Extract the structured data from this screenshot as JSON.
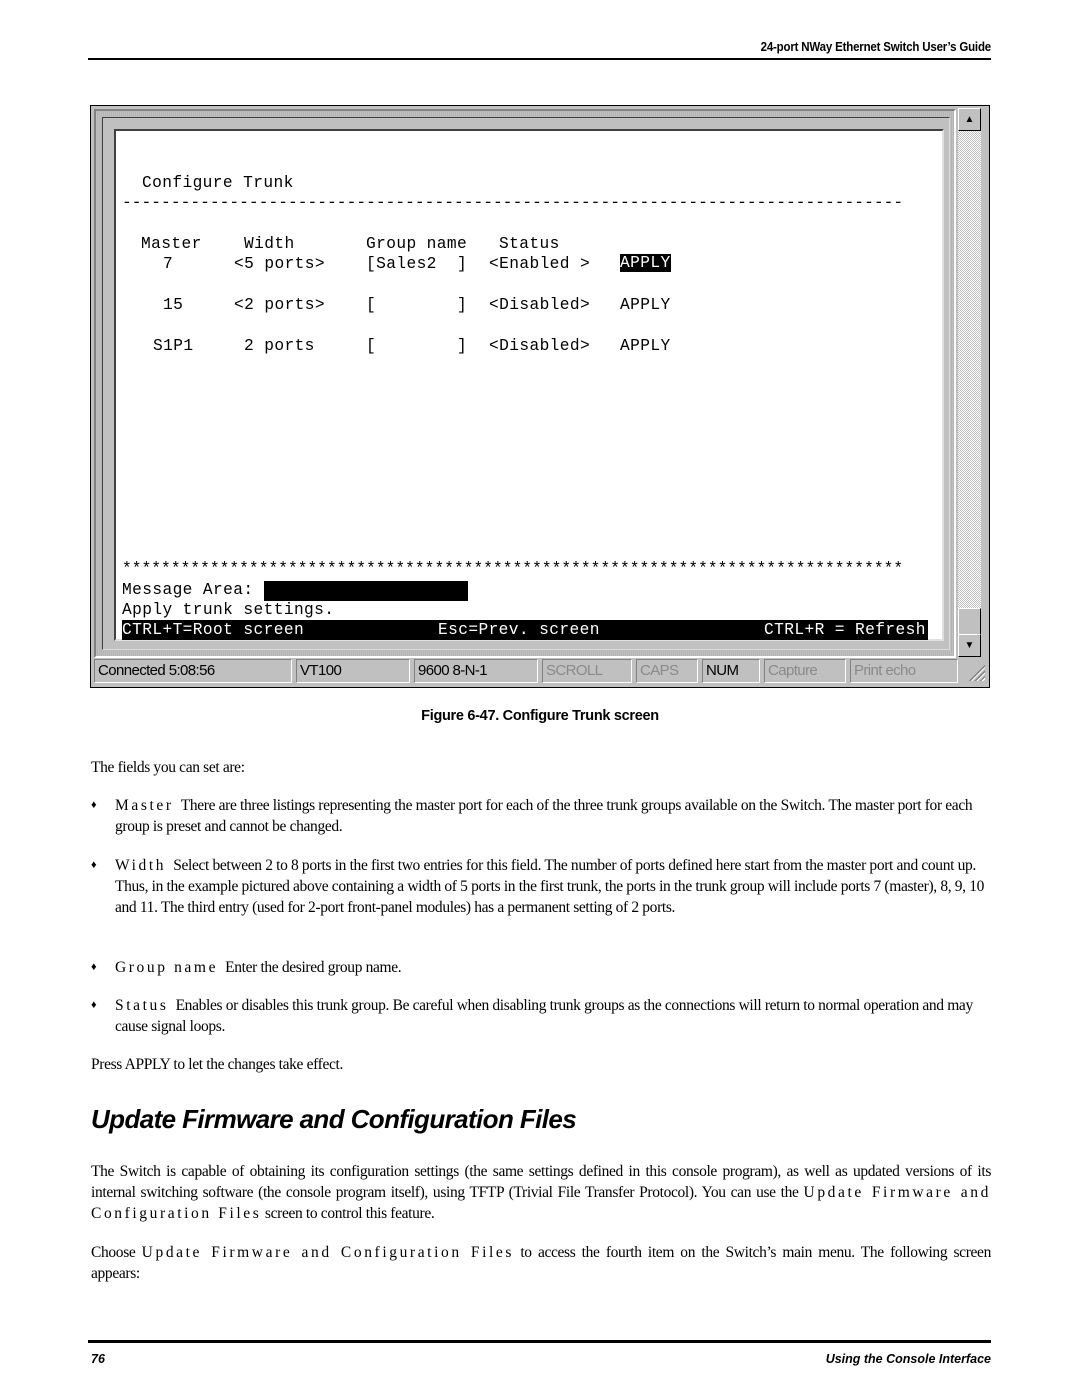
{
  "header": {
    "running_title": "24-port NWay Ethernet Switch User’s Guide"
  },
  "terminal": {
    "title": "Configure Trunk",
    "separator": "--------------------------------------------------------------------------------",
    "columns": [
      "Master",
      "Width",
      "Group name",
      "Status"
    ],
    "rows": [
      {
        "master": "7",
        "width": "<5 ports>",
        "group_name": "[Sales2  ]",
        "status": "<Enabled >",
        "action": "APPLY",
        "action_selected": true
      },
      {
        "master": "15",
        "width": "<2 ports>",
        "group_name": "[        ]",
        "status": "<Disabled>",
        "action": "APPLY",
        "action_selected": false
      },
      {
        "master": "S1P1",
        "width": "2 ports",
        "group_name": "[        ]",
        "status": "<Disabled>",
        "action": "APPLY",
        "action_selected": false
      }
    ],
    "star_line": "********************************************************************************",
    "message_label": "Message Area:",
    "message_text": "Apply trunk settings.",
    "footer_keys": {
      "root": "CTRL+T=Root screen",
      "prev": "Esc=Prev. screen",
      "refresh": "CTRL+R = Refresh"
    },
    "scrollbar": {
      "up_icon": "▲",
      "down_icon": "▼"
    }
  },
  "statusbar": {
    "connected": "Connected 5:08:56",
    "emulation": "VT100",
    "port_settings": "9600 8-N-1",
    "scroll": "SCROLL",
    "caps": "CAPS",
    "num": "NUM",
    "capture": "Capture",
    "print_echo": "Print echo"
  },
  "figure_caption": "Figure 6-47.  Configure Trunk screen",
  "intro": "The fields you can set are:",
  "fields": [
    {
      "term": "Master",
      "desc": "There are three listings representing the master port for each of the three trunk groups available on the Switch. The master port for each group is preset and cannot be changed."
    },
    {
      "term": "Width",
      "desc": "Select between 2 to 8 ports in the first two entries for this field. The number of ports defined here start from the master port and count up. Thus, in the example pictured above containing a width of 5 ports in the first trunk, the ports in the trunk group will include ports 7 (master), 8, 9, 10 and 11. The third entry (used for 2-port front-panel modules) has a permanent setting of 2 ports."
    },
    {
      "term": "Group name",
      "desc": "Enter the desired group name."
    },
    {
      "term": "Status",
      "desc": "Enables or disables this trunk group. Be careful when disabling trunk groups as the connections will return to normal operation and may cause signal loops."
    }
  ],
  "bullet_icon": "♦",
  "apply_note": "Press APPLY to let the changes take effect.",
  "section": {
    "title": "Update Firmware and Configuration Files",
    "p1_a": "The Switch is capable of obtaining its configuration settings (the same settings defined in this console program), as well as updated versions of its internal switching software (the console program itself), using TFTP (Trivial File Transfer Protocol). You can use the ",
    "p1_term": "Update Firmware and Configuration Files",
    "p1_b": " screen to control this feature.",
    "p2_a": "Choose ",
    "p2_term": "Update Firmware and Configuration Files",
    "p2_b": " to access the fourth item on the Switch’s main menu. The following screen appears:"
  },
  "footer": {
    "page_number": "76",
    "section_name": "Using the Console Interface"
  }
}
